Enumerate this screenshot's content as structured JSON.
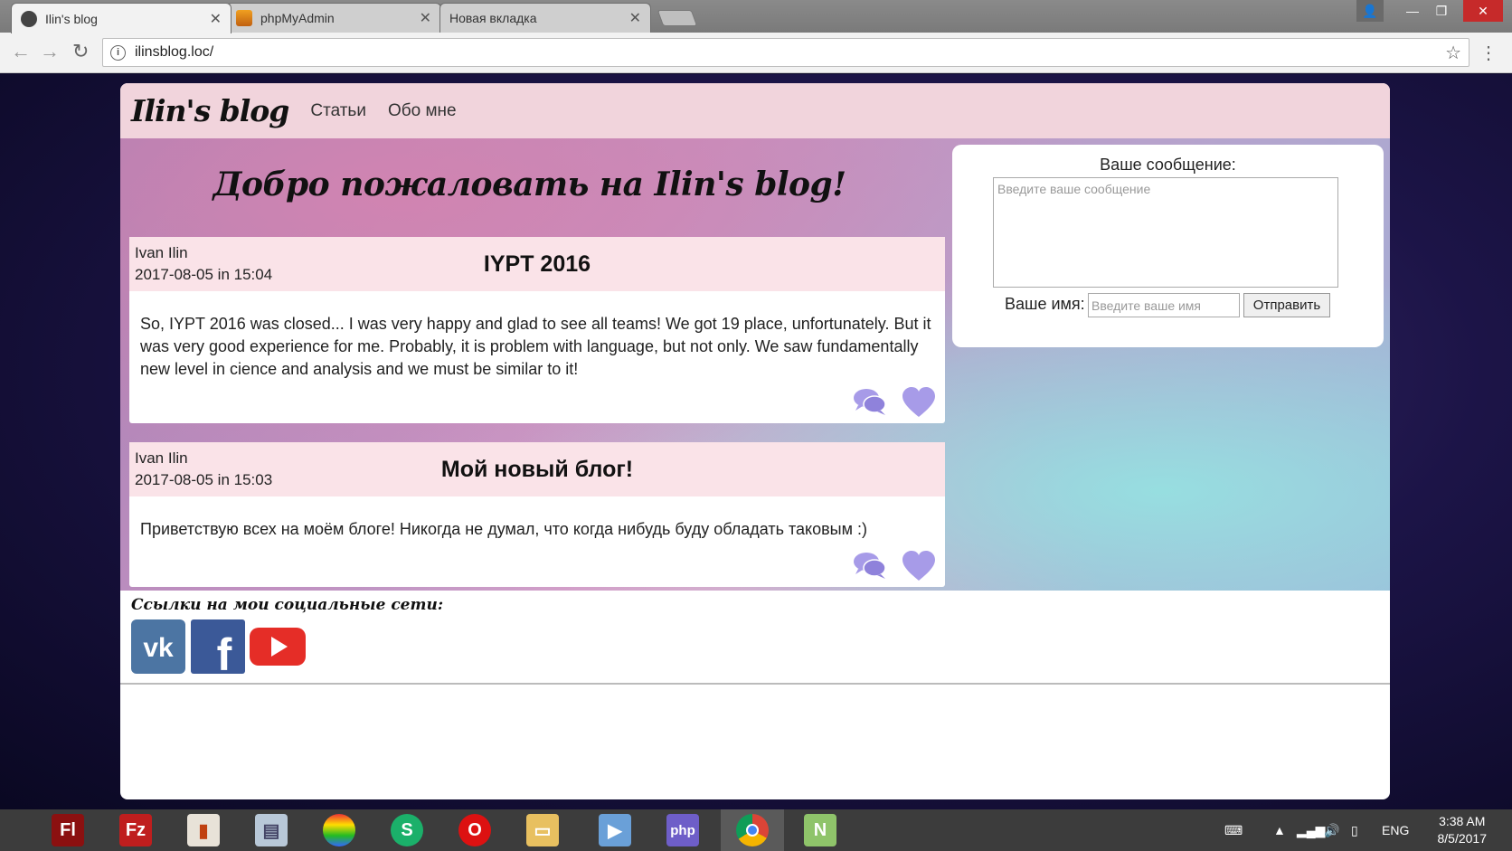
{
  "browser": {
    "tabs": [
      {
        "title": "Ilin's blog",
        "active": true
      },
      {
        "title": "phpMyAdmin",
        "active": false
      },
      {
        "title": "Новая вкладка",
        "active": false
      }
    ],
    "url": "ilinsblog.loc/"
  },
  "site": {
    "logo": "Ilin's blog",
    "nav": [
      "Статьи",
      "Обо мне"
    ],
    "welcome": "Добро пожаловать на Ilin's blog!",
    "posts": [
      {
        "author": "Ivan Ilin",
        "date": "2017-08-05 in 15:04",
        "title": "IYPT 2016",
        "body": "So, IYPT 2016 was closed... I was very happy and glad to see all teams! We got 19 place, unfortunately. But it was very good experience for me. Probably, it is problem with language, but not only. We saw fundamentally new level in cience and analysis and we must be similar to it!"
      },
      {
        "author": "Ivan Ilin",
        "date": "2017-08-05 in 15:03",
        "title": "Мой новый блог!",
        "body": "Приветствую всех на моём блоге! Никогда не думал, что когда нибудь буду обладать таковым :)"
      }
    ],
    "message_form": {
      "label": "Ваше сообщение:",
      "message_placeholder": "Введите ваше сообщение",
      "name_label": "Ваше имя:",
      "name_placeholder": "Введите ваше имя",
      "submit": "Отправить"
    },
    "social": {
      "title": "Ссылки на мои социальные сети:",
      "links": [
        "vk-icon",
        "facebook-icon",
        "youtube-icon"
      ]
    },
    "colors": {
      "header_bg": "#f1d4dc",
      "post_head_bg": "#fae3e8",
      "action_icon": "#a79be8"
    }
  },
  "taskbar": {
    "apps": [
      "Flash",
      "FileZilla",
      "Office",
      "Monitor",
      "Color",
      "Skype",
      "Opera",
      "Explorer",
      "Media",
      "PHPStorm",
      "Chrome",
      "Notepad++"
    ],
    "lang": "ENG",
    "time": "3:38 AM",
    "date": "8/5/2017"
  }
}
